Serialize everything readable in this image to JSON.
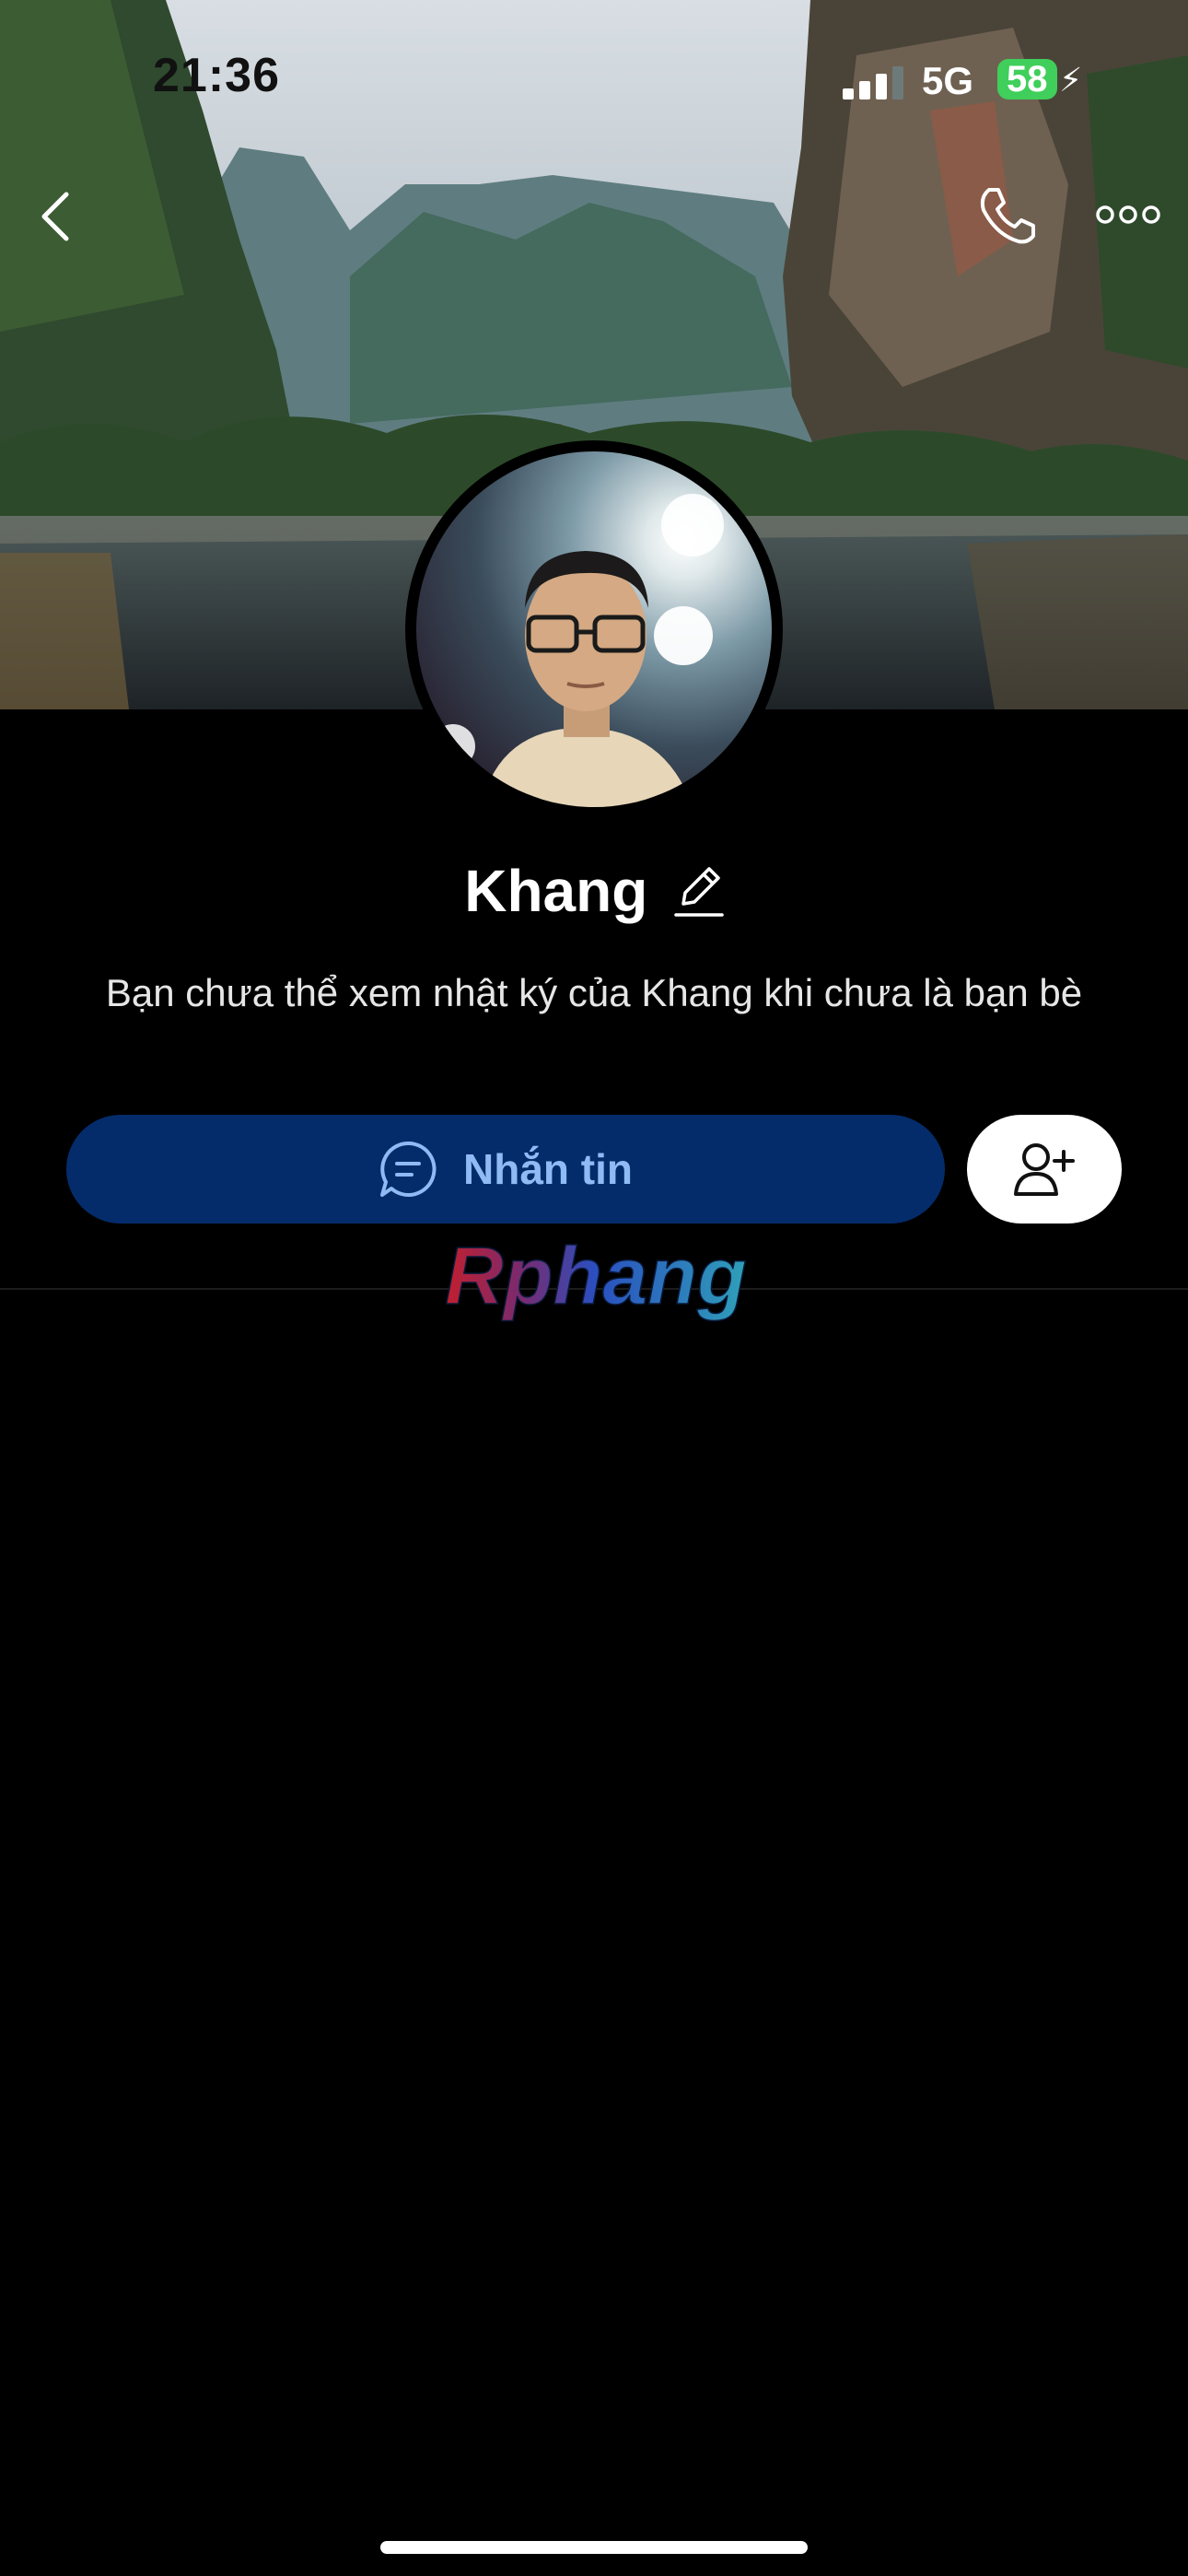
{
  "status_bar": {
    "time": "21:36",
    "network": "5G",
    "battery": "58"
  },
  "profile": {
    "name": "Khang",
    "info": "Bạn chưa thể xem nhật ký của Khang khi chưa là bạn bè"
  },
  "actions": {
    "message_label": "Nhắn tin"
  },
  "watermark": {
    "text": "Rphang"
  },
  "colors": {
    "background": "#000000",
    "message_button": "#042c6b",
    "message_text": "#8fbaf3",
    "battery": "#3fcf5a"
  },
  "icons": [
    "back-icon",
    "phone-icon",
    "more-icon",
    "edit-icon",
    "chat-icon",
    "add-friend-icon"
  ]
}
